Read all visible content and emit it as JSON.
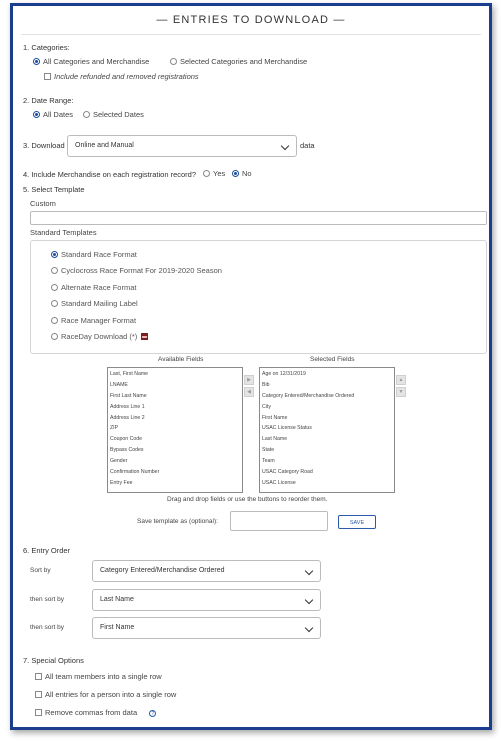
{
  "title": "ENTRIES TO DOWNLOAD",
  "categories": {
    "heading": "1. Categories:",
    "option_all": "All Categories and Merchandise",
    "option_selected": "Selected Categories and Merchandise",
    "include_refunded": "Include refunded and removed registrations"
  },
  "date_range": {
    "heading": "2. Date Range:",
    "option_all": "All Dates",
    "option_selected": "Selected Dates"
  },
  "download": {
    "prefix": "3. Download",
    "selected": "Online and Manual",
    "suffix": "data"
  },
  "merchandise": {
    "question": "4. Include Merchandise on each registration record?",
    "yes": "Yes",
    "no": "No"
  },
  "template": {
    "heading": "5. Select Template",
    "custom_label": "Custom",
    "custom_value": "",
    "standard_label": "Standard Templates",
    "options": [
      "Standard Race Format",
      "Cyclocross Race Format For 2019-2020 Season",
      "Alternate Race Format",
      "Standard Mailing Label",
      "Race Manager Format",
      "RaceDay Download (*)"
    ],
    "selected_index": 0
  },
  "fields": {
    "available_label": "Available Fields",
    "selected_label": "Selected Fields",
    "available": [
      "Last, First Name",
      "LNAME",
      "First Last Name",
      "Address Line 1",
      "Address Line 2",
      "ZIP",
      "Coupon Code",
      "Bypass Codes",
      "Gender",
      "Confirmation Number",
      "Entry Fee"
    ],
    "selected": [
      "Age on 12/31/2019",
      "Bib",
      "Category Entered/Merchandise Ordered",
      "City",
      "First Name",
      "USAC License Status",
      "Last Name",
      "State",
      "Team",
      "USAC Category Road",
      "USAC License"
    ],
    "hint": "Drag and drop fields or use the buttons to reorder them.",
    "save_label": "Save template as (optional):",
    "save_value": "",
    "save_button": "SAVE"
  },
  "entry_order": {
    "heading": "6. Entry Order",
    "sort_by_label": "Sort by",
    "sort_by_value": "Category Entered/Merchandise Ordered",
    "then1_label": "then sort by",
    "then1_value": "Last Name",
    "then2_label": "then sort by",
    "then2_value": "First Name"
  },
  "special": {
    "heading": "7. Special Options",
    "opt1": "All team members into a single row",
    "opt2": "All entries for a person into a single row",
    "opt3": "Remove commas from data",
    "help_glyph": "?"
  },
  "colors": {
    "frame": "#1a3d8f",
    "accent": "#1d4f99"
  }
}
